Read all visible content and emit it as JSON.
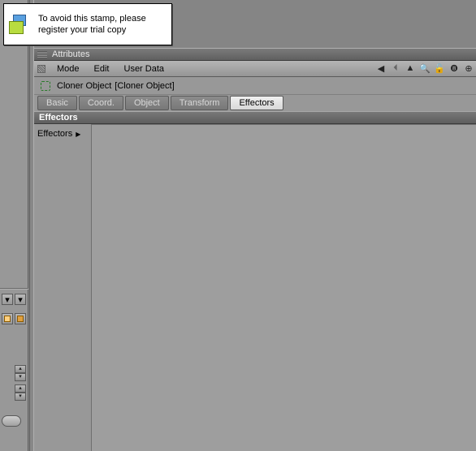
{
  "tooltip": {
    "line1": "To avoid this stamp, please",
    "line2": "register your trial copy"
  },
  "panel": {
    "title": "Attributes",
    "menu": {
      "mode": "Mode",
      "edit": "Edit",
      "userData": "User Data"
    },
    "object": {
      "type": "Cloner Object",
      "name": "[Cloner Object]"
    },
    "tabs": {
      "basic": "Basic",
      "coord": "Coord.",
      "object": "Object",
      "transform": "Transform",
      "effectors": "Effectors",
      "active": "effectors"
    },
    "section": {
      "header": "Effectors",
      "fieldLabel": "Effectors"
    }
  },
  "icons": {
    "navLeft": "◀",
    "curve": "⏴",
    "navUp": "▲",
    "search": "🔍",
    "lock": "🔓",
    "hist": "❽",
    "add": "⊕"
  }
}
